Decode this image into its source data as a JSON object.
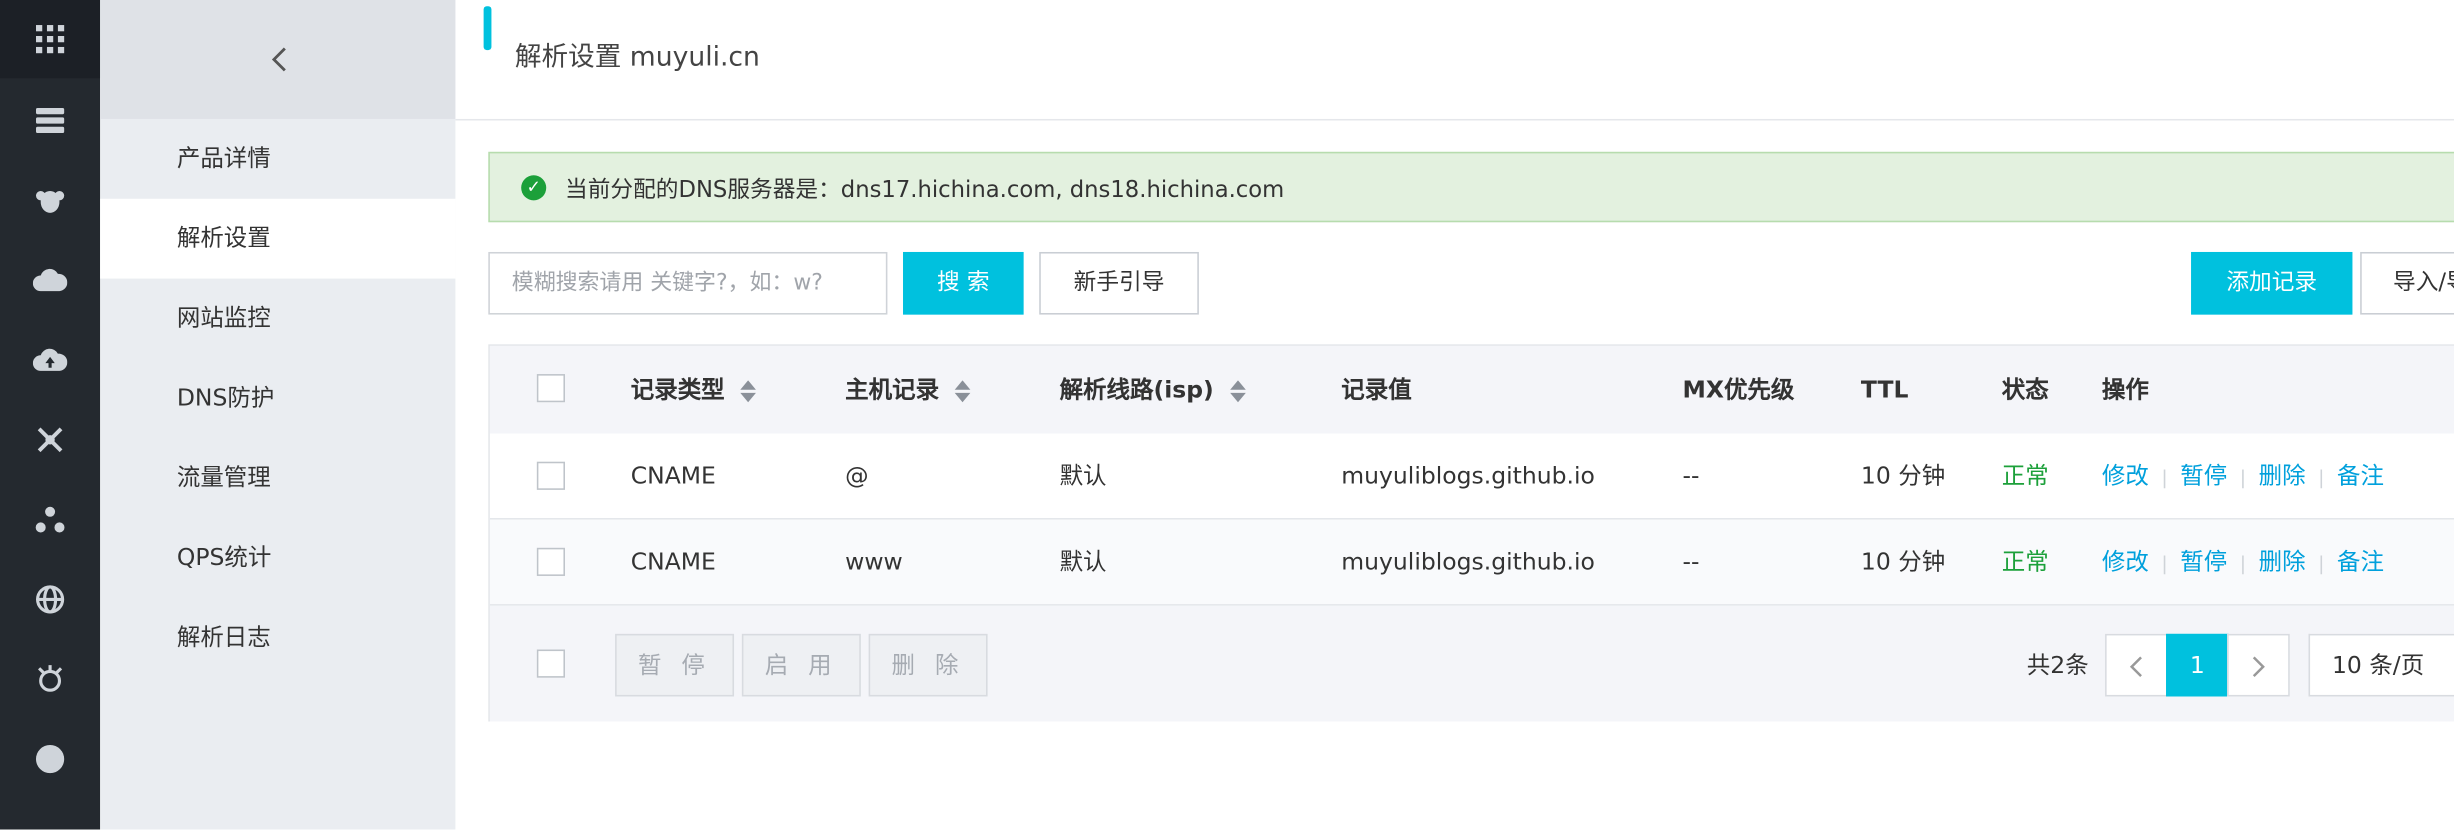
{
  "rail": {
    "icons": [
      "apps-grid-icon",
      "server-icon",
      "monkey-icon",
      "cloud-icon",
      "cloud-upload-icon",
      "network-icon",
      "cluster-icon",
      "globe-icon",
      "settings-bug-icon",
      "circle-icon"
    ]
  },
  "subnav": {
    "back_label": "<",
    "items": [
      {
        "label": "产品详情"
      },
      {
        "label": "解析设置"
      },
      {
        "label": "网站监控"
      },
      {
        "label": "DNS防护"
      },
      {
        "label": "流量管理"
      },
      {
        "label": "QPS统计"
      },
      {
        "label": "解析日志"
      }
    ],
    "active_index": 1
  },
  "header": {
    "title": "解析设置 muyuli.cn"
  },
  "notice": {
    "text": "当前分配的DNS服务器是：dns17.hichina.com, dns18.hichina.com"
  },
  "toolbar": {
    "search_placeholder": "模糊搜索请用 关键字?，如：w?",
    "search_button": "搜 索",
    "guide_button": "新手引导",
    "add_button": "添加记录",
    "import_button": "导入/导出"
  },
  "table": {
    "columns": [
      "记录类型",
      "主机记录",
      "解析线路(isp)",
      "记录值",
      "MX优先级",
      "TTL",
      "状态",
      "操作"
    ],
    "rows": [
      {
        "type": "CNAME",
        "host": "@",
        "line": "默认",
        "value": "muyuliblogs.github.io",
        "mx": "--",
        "ttl": "10 分钟",
        "status": "正常"
      },
      {
        "type": "CNAME",
        "host": "www",
        "line": "默认",
        "value": "muyuliblogs.github.io",
        "mx": "--",
        "ttl": "10 分钟",
        "status": "正常"
      }
    ],
    "actions": [
      "修改",
      "暂停",
      "删除",
      "备注"
    ],
    "bulk": {
      "pause": "暂 停",
      "enable": "启 用",
      "delete": "删 除"
    }
  },
  "pagination": {
    "total": "共2条",
    "current_page": "1",
    "page_size": "10 条/页",
    "prev": "<",
    "next": ">"
  },
  "colors": {
    "accent": "#00c1de",
    "success": "#1ca03a",
    "link": "#00a0dc"
  }
}
